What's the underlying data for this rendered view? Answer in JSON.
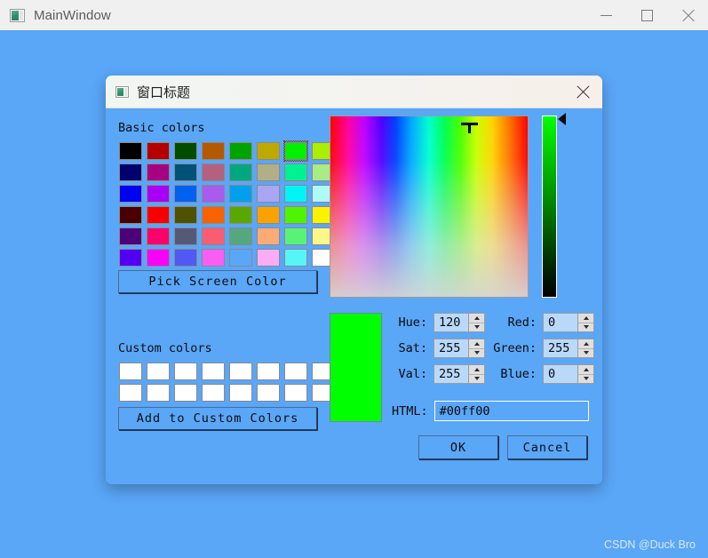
{
  "main_window": {
    "title": "MainWindow",
    "icon": "app-window-icon",
    "background_color": "#5aa6f7",
    "controls": {
      "minimize": "minimize-icon",
      "maximize": "maximize-icon",
      "close": "close-icon"
    }
  },
  "watermark": "CSDN @Duck Bro",
  "dialog": {
    "title": "窗口标题",
    "icon": "app-window-icon",
    "close_label": "close-icon",
    "basic_colors_label": "Basic colors",
    "custom_colors_label": "Custom colors",
    "pick_screen_color_label": "Pick Screen Color",
    "add_to_custom_colors_label": "Add to Custom Colors",
    "ok_label": "OK",
    "cancel_label": "Cancel",
    "basic_colors": [
      [
        "#000000",
        "#b40000",
        "#004d00",
        "#b35900",
        "#00a400",
        "#bfa800",
        "#00f000",
        "#aaee00"
      ],
      [
        "#00006e",
        "#a80082",
        "#005277",
        "#b4617f",
        "#00a880",
        "#b2ae85",
        "#00f191",
        "#a7ec85"
      ],
      [
        "#0000f4",
        "#a800f4",
        "#0060ef",
        "#a85bec",
        "#00a0ec",
        "#a9a6f4",
        "#00f4f4",
        "#adfbf8"
      ],
      [
        "#4a0000",
        "#f90000",
        "#4f5200",
        "#f86200",
        "#59a800",
        "#faa200",
        "#4ef300",
        "#fbf200"
      ],
      [
        "#4d0077",
        "#fa0068",
        "#565877",
        "#f95d72",
        "#55a77e",
        "#fcaa76",
        "#59f277",
        "#fdf787"
      ],
      [
        "#5200f4",
        "#f900f7",
        "#5158f3",
        "#fa5df4",
        "#5aa6f7",
        "#fcacf5",
        "#57f6f5",
        "#ffffff"
      ]
    ],
    "selected_basic_color_index": [
      0,
      6
    ],
    "custom_colors": [
      [
        "#ffffff",
        "#ffffff",
        "#ffffff",
        "#ffffff",
        "#ffffff",
        "#ffffff",
        "#ffffff",
        "#ffffff"
      ],
      [
        "#ffffff",
        "#ffffff",
        "#ffffff",
        "#ffffff",
        "#ffffff",
        "#ffffff",
        "#ffffff",
        "#ffffff"
      ]
    ],
    "preview_color": "#00ff00",
    "fields": {
      "hue": {
        "label": "Hue:",
        "value": "120"
      },
      "sat": {
        "label": "Sat:",
        "value": "255"
      },
      "val": {
        "label": "Val:",
        "value": "255"
      },
      "red": {
        "label": "Red:",
        "value": "0"
      },
      "green": {
        "label": "Green:",
        "value": "255"
      },
      "blue": {
        "label": "Blue:",
        "value": "0"
      },
      "html": {
        "label": "HTML:",
        "value": "#00ff00"
      }
    }
  }
}
